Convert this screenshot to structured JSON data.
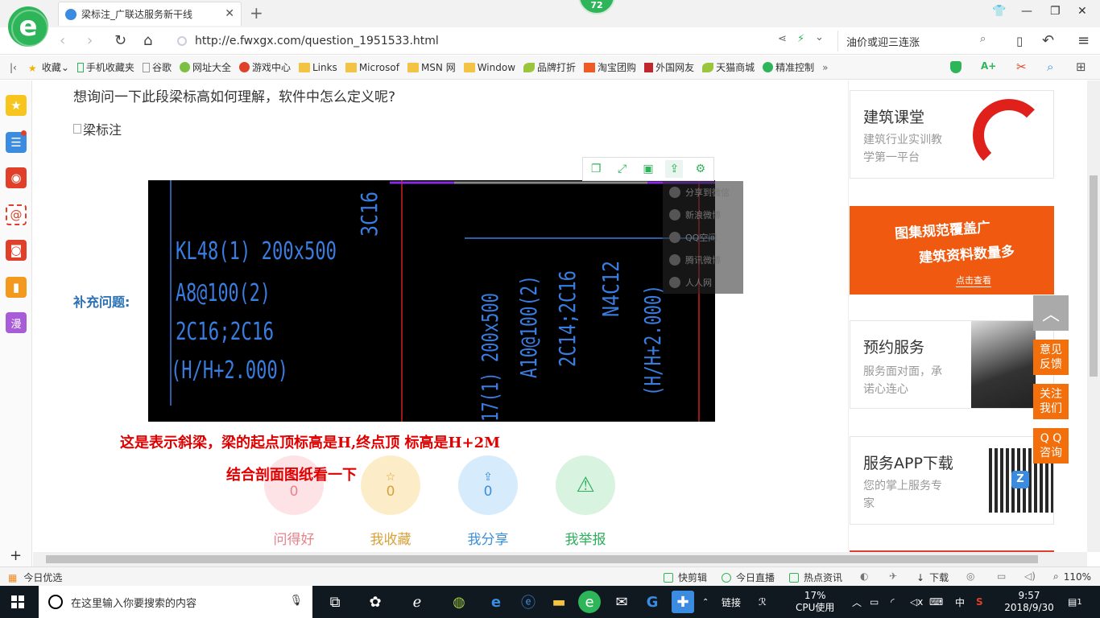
{
  "browser": {
    "tab_title": "梁标注_广联达服务新干线",
    "badge_count": "72",
    "url": "http://e.fwxgx.com/question_1951533.html",
    "search_text": "油价或迎三连涨"
  },
  "bookmarks": [
    {
      "label": "收藏",
      "icon": "star-icon"
    },
    {
      "label": "手机收藏夹",
      "icon": "phone-icon"
    },
    {
      "label": "谷歌",
      "icon": "page-icon"
    },
    {
      "label": "网址大全",
      "icon": "globe-icon"
    },
    {
      "label": "游戏中心",
      "icon": "game-icon"
    },
    {
      "label": "Links",
      "icon": "folder-icon"
    },
    {
      "label": "Microsof",
      "icon": "folder-icon"
    },
    {
      "label": "MSN 网",
      "icon": "folder-icon"
    },
    {
      "label": "Window",
      "icon": "folder-icon"
    },
    {
      "label": "品牌打折",
      "icon": "leaf-icon"
    },
    {
      "label": "淘宝团购",
      "icon": "taobao-icon"
    },
    {
      "label": "外国网友",
      "icon": "bookmark-icon"
    },
    {
      "label": "天猫商城",
      "icon": "leaf-icon"
    },
    {
      "label": "精准控制",
      "icon": "chat-icon"
    }
  ],
  "page": {
    "question": "想询问一下此段梁标高如何理解，软件中怎么定义呢?",
    "image_alt": "梁标注",
    "supplement_label": "补充问题:",
    "answer_line1": "这是表示斜梁，梁的起点顶标高是H,终点顶 标高是H+2M",
    "answer_line2": "结合剖面图纸看一下",
    "share_menu": [
      "分享到微信",
      "新浪微博",
      "QQ空间",
      "腾讯微博",
      "人人网"
    ],
    "actions": [
      {
        "label": "问得好",
        "count": "0",
        "color": "#e8828c",
        "bg": "#fde3e6"
      },
      {
        "label": "我收藏",
        "count": "0",
        "color": "#d8a23a",
        "bg": "#fdecc8"
      },
      {
        "label": "我分享",
        "count": "0",
        "color": "#3e8fd8",
        "bg": "#d6ebfb"
      },
      {
        "label": "我举报",
        "count": "",
        "color": "#2fae5c",
        "bg": "#d8f3e0"
      }
    ]
  },
  "cad": {
    "left_lines": [
      "KL48(1) 200x500",
      "A8@100(2)",
      "2C16;2C16",
      "(H/H+2.000)"
    ],
    "top_label": "3C16",
    "right_vertical": [
      "N4C12",
      "(H/H+2.000)",
      "2C14;2C16",
      "A10@100(2)",
      "17(1) 200x500"
    ]
  },
  "sidebar_cards": [
    {
      "title": "建筑课堂",
      "desc1": "建筑行业实训教",
      "desc2": "学第一平台"
    },
    {
      "banner_line1": "图集规范覆盖广",
      "banner_line2": "建筑资料数量多",
      "banner_cta": "点击查看"
    },
    {
      "title": "预约服务",
      "desc1": "服务面对面，承",
      "desc2": "诺心连心"
    },
    {
      "title": "服务APP下载",
      "desc1": "您的掌上服务专",
      "desc2": "家"
    }
  ],
  "float_buttons": [
    "意见反馈",
    "关注我们",
    "Q Q咨询"
  ],
  "status": {
    "left": "今日优选",
    "items": [
      "快剪辑",
      "今日直播",
      "热点资讯",
      "下载"
    ],
    "zoom": "110%"
  },
  "taskbar": {
    "search_placeholder": "在这里输入你要搜索的内容",
    "link_label": "链接",
    "cpu_percent": "17%",
    "cpu_label": "CPU使用",
    "ime": "中",
    "time": "9:57",
    "date": "2018/9/30",
    "notifications": "1"
  }
}
